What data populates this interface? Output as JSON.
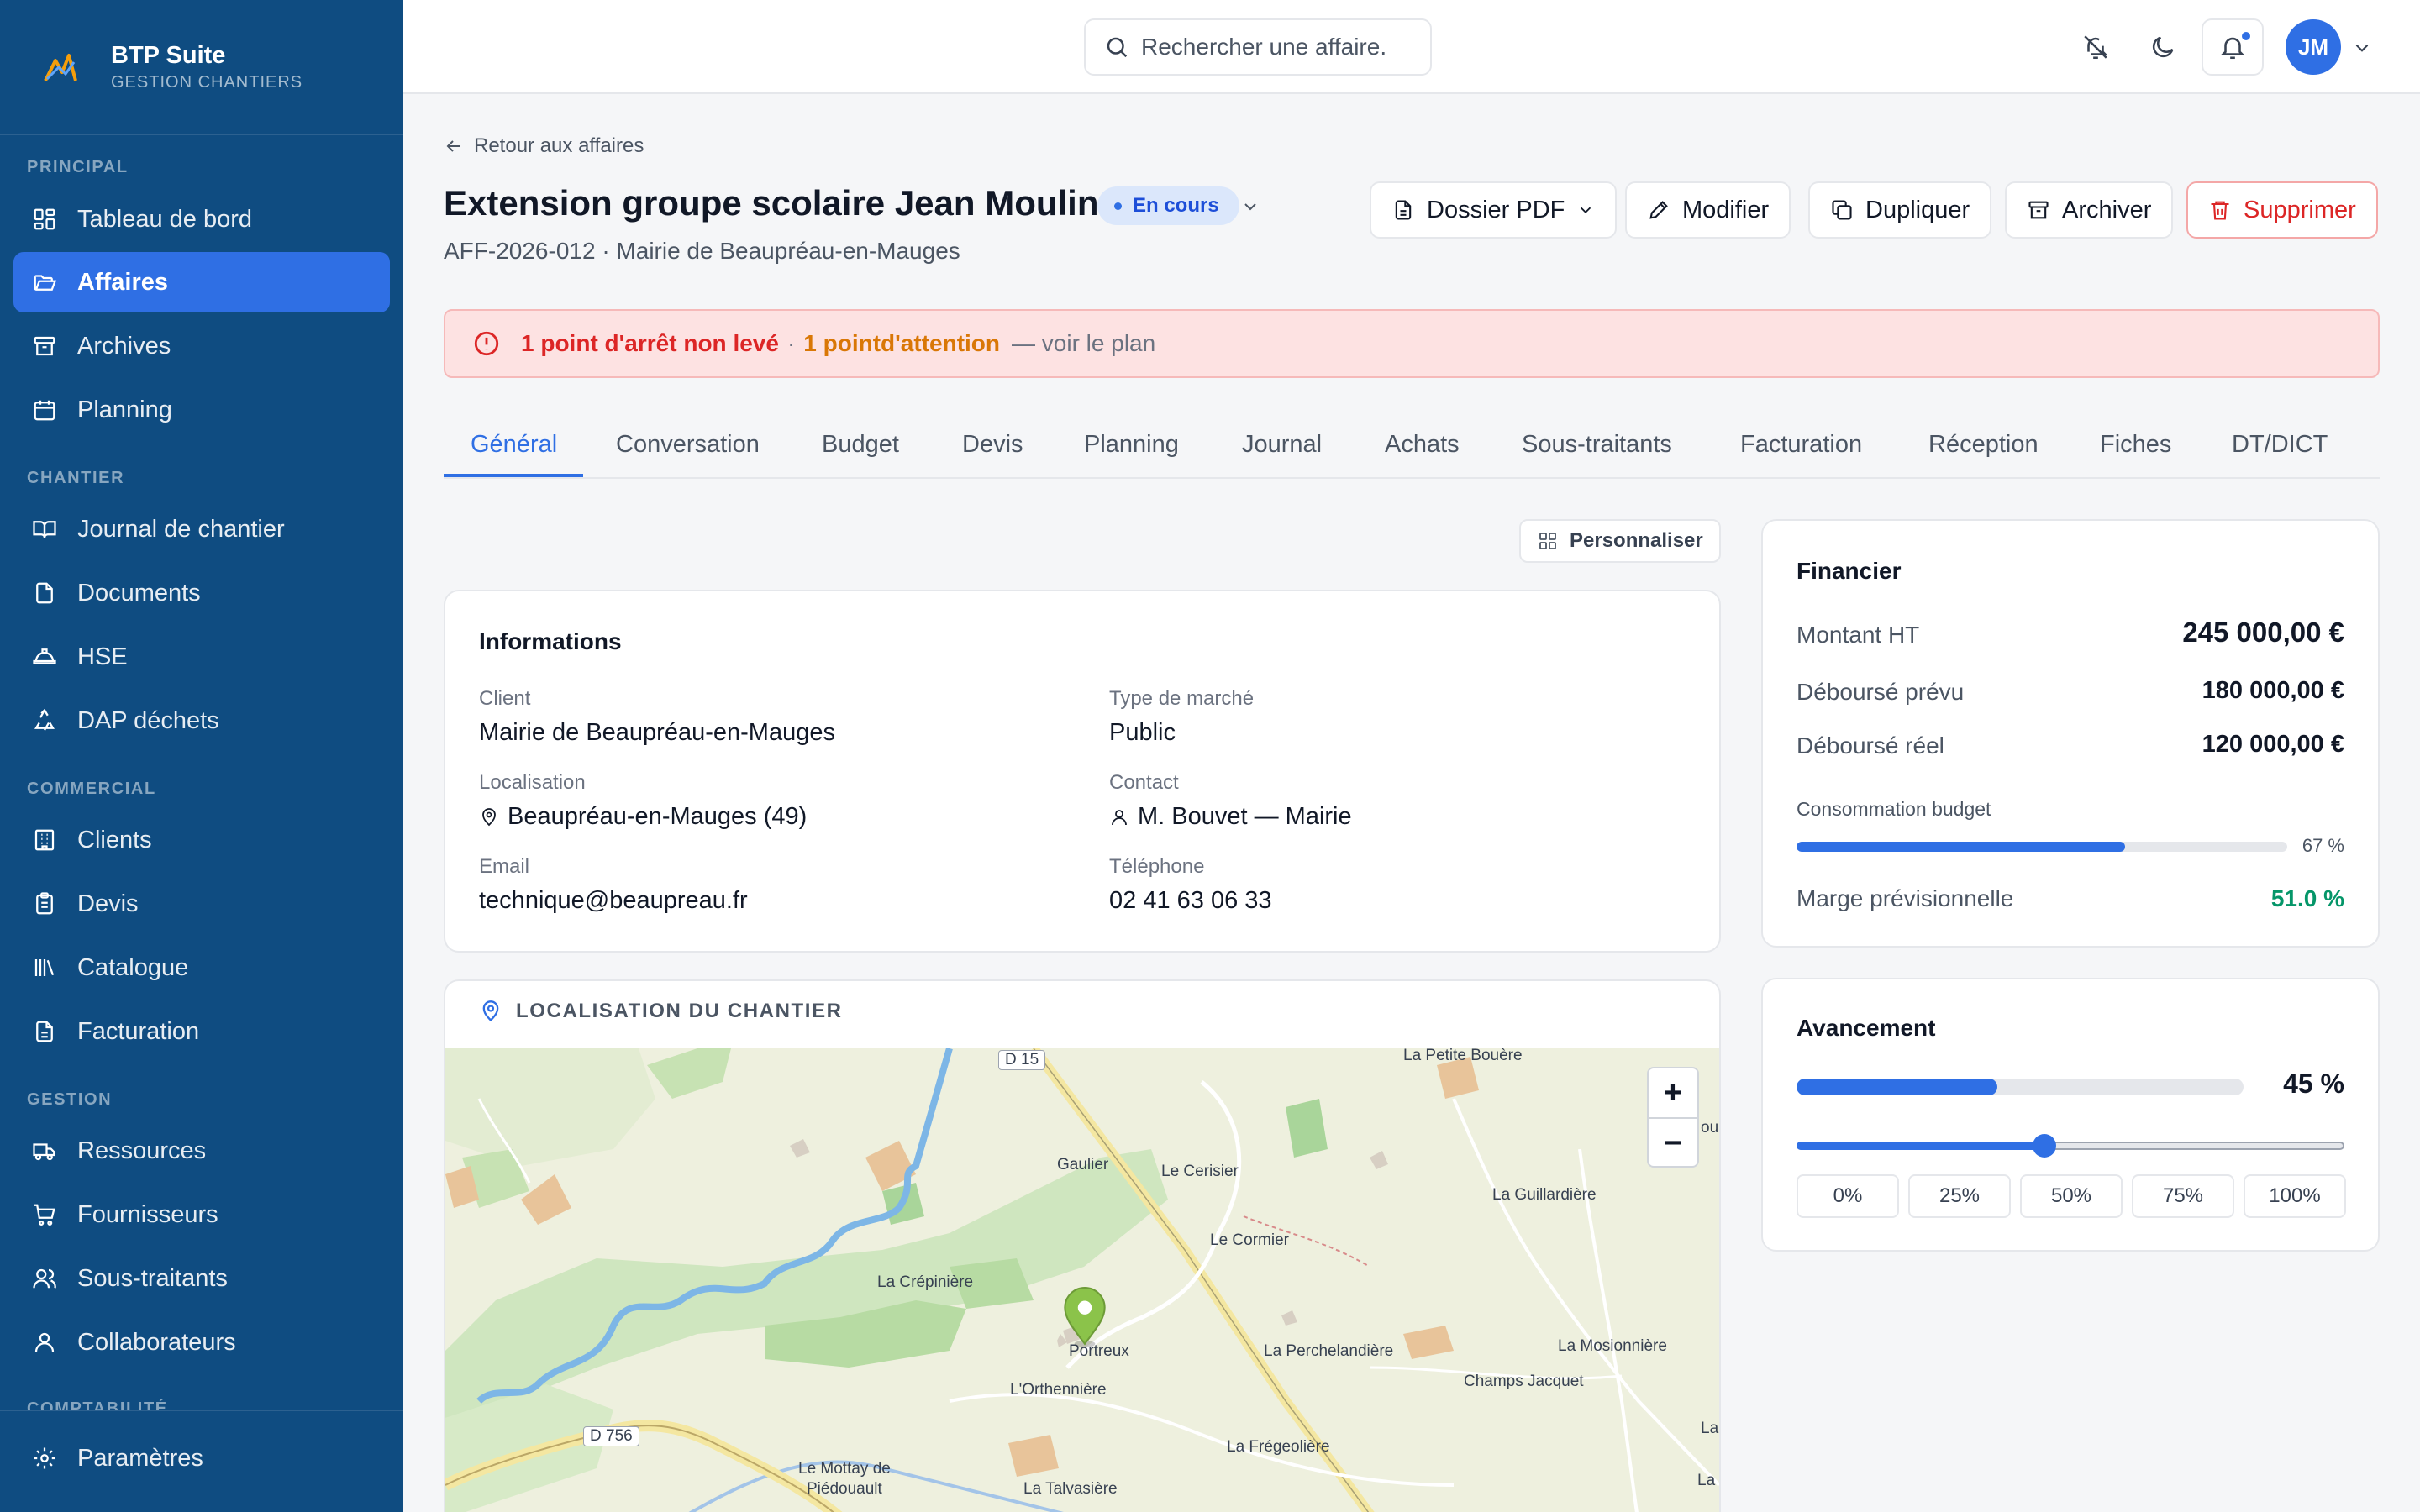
{
  "brand": {
    "name": "BTP Suite",
    "subtitle": "GESTION CHANTIERS"
  },
  "sidebar": {
    "sections": [
      {
        "title": "PRINCIPAL",
        "items": [
          {
            "label": "Tableau de bord",
            "icon": "dashboard-icon"
          },
          {
            "label": "Affaires",
            "icon": "folder-icon",
            "active": true
          },
          {
            "label": "Archives",
            "icon": "archive-icon"
          },
          {
            "label": "Planning",
            "icon": "calendar-icon"
          }
        ]
      },
      {
        "title": "CHANTIER",
        "items": [
          {
            "label": "Journal de chantier",
            "icon": "book-icon"
          },
          {
            "label": "Documents",
            "icon": "documents-icon"
          },
          {
            "label": "HSE",
            "icon": "helmet-icon"
          },
          {
            "label": "DAP déchets",
            "icon": "recycle-icon"
          }
        ]
      },
      {
        "title": "COMMERCIAL",
        "items": [
          {
            "label": "Clients",
            "icon": "building-icon"
          },
          {
            "label": "Devis",
            "icon": "clipboard-icon"
          },
          {
            "label": "Catalogue",
            "icon": "library-icon"
          },
          {
            "label": "Facturation",
            "icon": "invoice-icon"
          }
        ]
      },
      {
        "title": "GESTION",
        "items": [
          {
            "label": "Ressources",
            "icon": "truck-icon"
          },
          {
            "label": "Fournisseurs",
            "icon": "cart-icon"
          },
          {
            "label": "Sous-traitants",
            "icon": "users-icon"
          },
          {
            "label": "Collaborateurs",
            "icon": "user-icon"
          }
        ]
      },
      {
        "title": "COMPTABILITÉ",
        "items": []
      }
    ],
    "settings_label": "Paramètres"
  },
  "topbar": {
    "search_placeholder": "Rechercher une affaire.",
    "avatar_initials": "JM"
  },
  "header": {
    "back_label": "Retour aux affaires",
    "title": "Extension groupe scolaire Jean Moulin",
    "status": "En cours",
    "subtitle": "AFF-2026-012 · Mairie de Beaupréau-en-Mauges",
    "actions": {
      "pdf": "Dossier PDF",
      "edit": "Modifier",
      "duplicate": "Dupliquer",
      "archive": "Archiver",
      "delete": "Supprimer"
    }
  },
  "alert": {
    "stop_points": "1 point d'arrêt non levé",
    "separator": "·",
    "attention": "1 pointd'attention",
    "suffix": "— voir le plan"
  },
  "tabs": [
    "Général",
    "Conversation",
    "Budget",
    "Devis",
    "Planning",
    "Journal",
    "Achats",
    "Sous-traitants",
    "Facturation",
    "Réception",
    "Fiches",
    "DT/DICT"
  ],
  "customize_label": "Personnaliser",
  "informations": {
    "title": "Informations",
    "client_label": "Client",
    "client_value": "Mairie de Beaupréau-en-Mauges",
    "market_label": "Type de marché",
    "market_value": "Public",
    "location_label": "Localisation",
    "location_value": "Beaupréau-en-Mauges (49)",
    "contact_label": "Contact",
    "contact_value": "M. Bouvet — Mairie",
    "email_label": "Email",
    "email_value": "technique@beaupreau.fr",
    "phone_label": "Téléphone",
    "phone_value": "02 41 63 06 33"
  },
  "map": {
    "title": "LOCALISATION DU CHANTIER",
    "zoom_in": "+",
    "zoom_out": "−",
    "labels": {
      "d15": "D 15",
      "petite_bouere": "La Petite Bouère",
      "gaulier": "Gaulier",
      "cerisier": "Le Cerisier",
      "guillardiere": "La Guillardière",
      "cormier": "Le Cormier",
      "crepiniere": "La Crépinière",
      "portreux": "Portreux",
      "perchelandiere": "La Perchelandière",
      "mosionniere": "La Mosionnière",
      "champs_jacquet": "Champs Jacquet",
      "orthenniere": "L'Orthennière",
      "d756": "D 756",
      "mottay": "Le Mottay de",
      "piedouault": "Piédouault",
      "fregeoliere": "La Frégeolière",
      "talvasiere": "La Talvasière",
      "edge_ou": "ou",
      "edge_la1": "La",
      "edge_la2": "La"
    }
  },
  "financier": {
    "title": "Financier",
    "montant_label": "Montant HT",
    "montant_value": "245 000,00 €",
    "prevu_label": "Déboursé prévu",
    "prevu_value": "180 000,00 €",
    "reel_label": "Déboursé réel",
    "reel_value": "120 000,00 €",
    "budget_label": "Consommation budget",
    "budget_pct": 67,
    "budget_pct_text": "67 %",
    "marge_label": "Marge prévisionnelle",
    "marge_value": "51.0 %"
  },
  "avancement": {
    "title": "Avancement",
    "value": 45,
    "value_text": "45 %",
    "presets": [
      "0%",
      "25%",
      "50%",
      "75%",
      "100%"
    ]
  },
  "colors": {
    "sidebar_bg": "#0f4c81",
    "accent": "#2f6fe4",
    "danger": "#dc2626",
    "warning": "#d97706",
    "success": "#059669"
  }
}
